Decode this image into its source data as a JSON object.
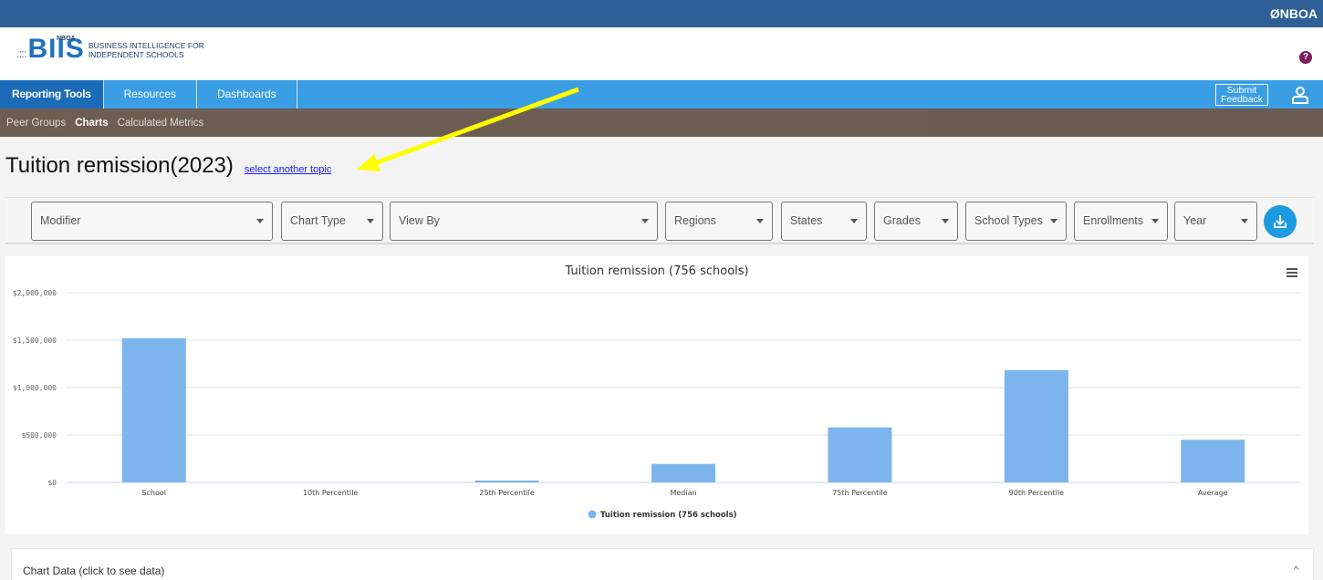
{
  "topbar": {
    "brand": "ØNBOA"
  },
  "logo": {
    "small": "NBOA",
    "name": "BIIS",
    "tagline_1": "BUSINESS INTELLIGENCE FOR",
    "tagline_2": "INDEPENDENT SCHOOLS"
  },
  "help": {
    "label": "?"
  },
  "main_nav": {
    "tabs": [
      {
        "label": "Reporting Tools",
        "active": true
      },
      {
        "label": "Resources"
      },
      {
        "label": "Dashboards"
      }
    ],
    "feedback_line1": "Submit",
    "feedback_line2": "Feedback"
  },
  "sub_nav": {
    "items": [
      {
        "label": "Peer Groups"
      },
      {
        "label": "Charts",
        "active": true
      },
      {
        "label": "Calculated Metrics"
      }
    ]
  },
  "page": {
    "title": "Tuition remission(2023)",
    "topic_link": "select another topic"
  },
  "filters": [
    {
      "label": "Modifier"
    },
    {
      "label": "Chart Type"
    },
    {
      "label": "View By"
    },
    {
      "label": "Regions"
    },
    {
      "label": "States"
    },
    {
      "label": "Grades"
    },
    {
      "label": "School Types"
    },
    {
      "label": "Enrollments"
    },
    {
      "label": "Year"
    }
  ],
  "chart_data": {
    "type": "bar",
    "title": "Tuition remission (756 schools)",
    "categories": [
      "School",
      "10th Percentile",
      "25th Percentile",
      "Median",
      "75th Percentile",
      "90th Percentile",
      "Average"
    ],
    "series": [
      {
        "name": "Tuition remission (756 schools)",
        "values": [
          1520000,
          0,
          20000,
          195000,
          580000,
          1185000,
          450000
        ],
        "color": "#7cb5ec"
      }
    ],
    "yticks": [
      "$0",
      "$500,000",
      "$1,000,000",
      "$1,500,000",
      "$2,000,000"
    ],
    "ylim": [
      0,
      2000000
    ],
    "grid": true,
    "legend": "bottom-center"
  },
  "data_panel": {
    "label": "Chart Data (click to see data)",
    "toggle": "^"
  },
  "colors": {
    "topbar": "#2e5f96",
    "nav": "#3a9ee4",
    "nav_active": "#1b6bb8",
    "subnav": "#6d5d52",
    "accent": "#1e9ae0",
    "annotation": "#ffff00"
  }
}
